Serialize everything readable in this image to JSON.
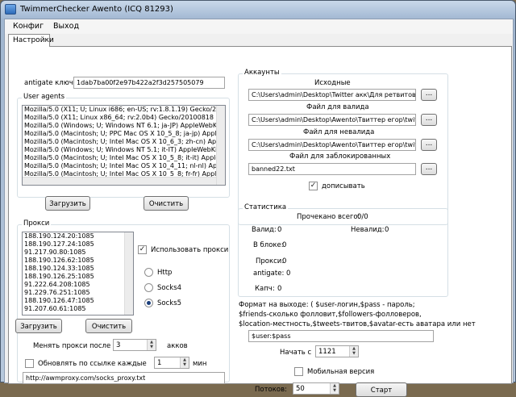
{
  "window": {
    "title": "TwimmerChecker   Awento (ICQ 81293)"
  },
  "menu": {
    "items": [
      "Конфиг",
      "Выход"
    ]
  },
  "tabs": [
    "Настройки"
  ],
  "antigate": {
    "label": "antigate ключ",
    "value": "1dab7ba00f2e97b422a2f3d257505079"
  },
  "user_agents": {
    "title": "User agents",
    "items": [
      "Mozilla/5.0 (X11; U; Linux i686; en-US; rv:1.8.1.19) Gecko/20",
      "Mozilla/5.0 (X11; Linux x86_64; rv:2.0b4) Gecko/20100818 Fi",
      "Mozilla/5.0 (Windows; U; Windows NT 6.1; ja-JP) AppleWebKi",
      "Mozilla/5.0 (Macintosh; U; PPC Mac OS X 10_5_8; ja-jp) Apple",
      "Mozilla/5.0 (Macintosh; U; Intel Mac OS X 10_6_3; zh-cn) Appl",
      "Mozilla/5.0 (Windows; U; Windows NT 5.1; it-IT) AppleWebKit/",
      "Mozilla/5.0 (Macintosh; U; Intel Mac OS X 10_5_8; it-it) Apple",
      "Mozilla/5.0 (Macintosh; U; Intel Mac OS X 10_4_11; nl-nl) Appl",
      "Mozilla/5.0 (Macintosh; U; Intel Mac OS X 10_5_8; fr-fr) Apple"
    ],
    "load_button": "Загрузить",
    "clear_button": "Очистить"
  },
  "proxy": {
    "title": "Прокси",
    "items": [
      "188.190.124.20:1085",
      "188.190.127.24:1085",
      "91.217.90.80:1085",
      "188.190.126.62:1085",
      "188.190.124.33:1085",
      "188.190.126.25:1085",
      "91.222.64.208:1085",
      "91.229.76.251:1085",
      "188.190.126.47:1085",
      "91.207.60.61:1085"
    ],
    "use_proxy_label": "Использовать прокси",
    "use_proxy_checked": true,
    "types": [
      "Http",
      "Socks4",
      "Socks5"
    ],
    "selected_type": "Socks5",
    "load_button": "Загрузить",
    "clear_button": "Очистить",
    "change_after_label": "Менять прокси после",
    "change_after_value": "3",
    "change_after_unit": "акков",
    "refresh_label": "Обновлять по ссылке каждые",
    "refresh_checked": false,
    "refresh_value": "1",
    "refresh_unit": "мин",
    "url": "http://awmproxy.com/socks_proxy.txt"
  },
  "accounts": {
    "title": "Аккаунты",
    "source_label": "Исходные",
    "source_path": "C:\\Users\\admin\\Desktop\\Twitter акк\\Для ретвитов",
    "valid_label": "Файл для валида",
    "valid_path": "C:\\Users\\admin\\Desktop\\Awento\\Твиттер егор\\twit",
    "invalid_label": "Файл для невалида",
    "invalid_path": "C:\\Users\\admin\\Desktop\\Awento\\Твиттер егор\\twit",
    "blocked_label": "Файл для заблокированных",
    "blocked_path": "banned22.txt",
    "browse": "...",
    "append_label": "дописывать",
    "append_checked": true
  },
  "stats": {
    "title": "Статистика",
    "checked_total_label": "Прочекано всего:",
    "checked_total_value": "0/0",
    "valid_label": "Валид:",
    "valid_value": "0",
    "invalid_label": "Невалид:",
    "invalid_value": "0",
    "blocked_label": "В блоке:",
    "blocked_value": "0",
    "proxy_label": "Прокси:",
    "proxy_value": "0",
    "antigate_label": "antigate:",
    "antigate_value": "0",
    "captcha_label": "Капч:",
    "captcha_value": "0"
  },
  "output": {
    "format_text_1": "Формат на выходе: ( $user-логин,$pass - пароль;",
    "format_text_2": "$friends-сколько фолловит,$followers-фолловеров,",
    "format_text_3": "$location-местность,$tweets-твитов,$avatar-есть аватара или нет",
    "format_value": "$user:$pass",
    "start_from_label": "Начать с",
    "start_from_value": "1121",
    "mobile_label": "Мобильная версия",
    "mobile_checked": false,
    "threads_label": "Потоков:",
    "threads_value": "50",
    "start_button": "Старт"
  }
}
